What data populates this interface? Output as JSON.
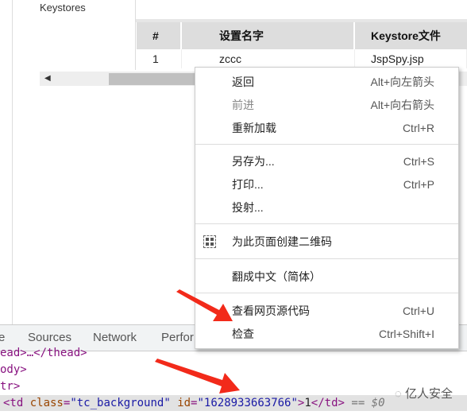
{
  "sidebar": {
    "item": "Keystores"
  },
  "table": {
    "headers": [
      "#",
      "设置名字",
      "Keystore文件"
    ],
    "rows": [
      [
        "1",
        "zccc",
        "JspSpy.jsp"
      ]
    ]
  },
  "devtools": {
    "tabs": [
      "e",
      "Sources",
      "Network",
      "Perfor"
    ],
    "code": {
      "line1": "ead>…</thead>",
      "line2": "ody>",
      "line3": "tr>",
      "selected": {
        "open": "<td ",
        "attr1": "class",
        "val1": "\"tc_background\"",
        "attr2": "id",
        "val2": "\"1628933663766\"",
        "text": "1",
        "close": "</td>",
        "marker": "== $0"
      }
    }
  },
  "context_menu": {
    "items": [
      {
        "label": "返回",
        "shortcut": "Alt+向左箭头",
        "disabled": false
      },
      {
        "label": "前进",
        "shortcut": "Alt+向右箭头",
        "disabled": true
      },
      {
        "label": "重新加载",
        "shortcut": "Ctrl+R",
        "disabled": false
      },
      {
        "label": "另存为...",
        "shortcut": "Ctrl+S",
        "disabled": false
      },
      {
        "label": "打印...",
        "shortcut": "Ctrl+P",
        "disabled": false
      },
      {
        "label": "投射...",
        "shortcut": "",
        "disabled": false
      },
      {
        "label": "为此页面创建二维码",
        "shortcut": "",
        "icon": "qr-code-icon",
        "disabled": false
      },
      {
        "label": "翻成中文（简体）",
        "shortcut": "",
        "disabled": false
      },
      {
        "label": "查看网页源代码",
        "shortcut": "Ctrl+U",
        "disabled": false
      },
      {
        "label": "检查",
        "shortcut": "Ctrl+Shift+I",
        "disabled": false
      }
    ]
  },
  "watermark": "亿人安全",
  "colors": {
    "arrow": "#f22a1a",
    "tag": "#881280",
    "attr": "#994500",
    "value": "#1a1aa6"
  }
}
